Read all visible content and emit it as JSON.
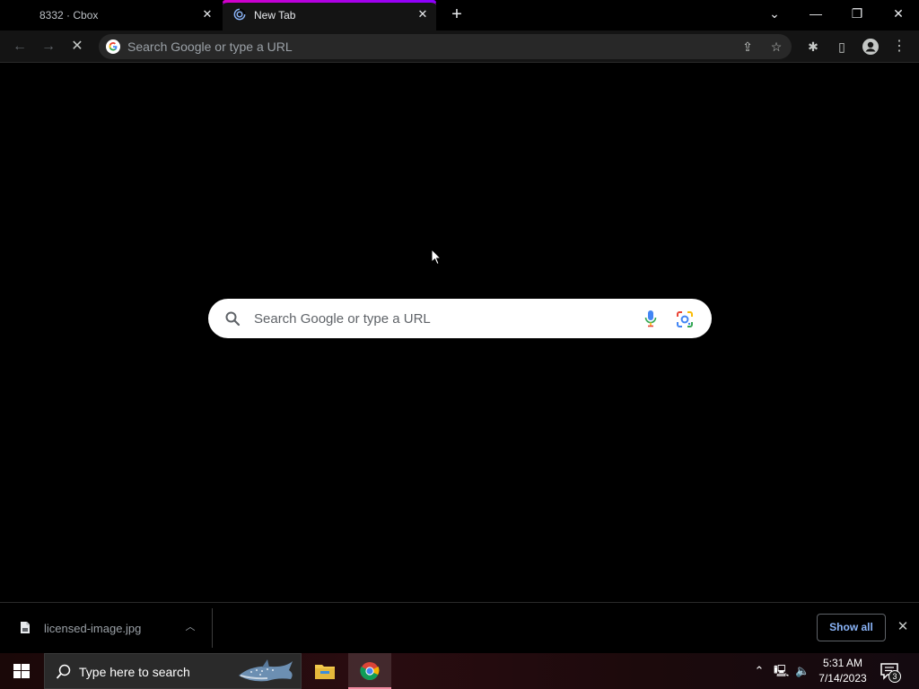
{
  "browser": {
    "tabs": [
      {
        "title": "8332 · Cbox",
        "active": false
      },
      {
        "title": "New Tab",
        "active": true
      }
    ],
    "omnibox": {
      "placeholder": "Search Google or type a URL"
    }
  },
  "ntp": {
    "search_placeholder": "Search Google or type a URL"
  },
  "download_bar": {
    "filename": "licensed-image.jpg",
    "show_all_label": "Show all"
  },
  "taskbar": {
    "search_placeholder": "Type here to search",
    "time": "5:31 AM",
    "date": "7/14/2023",
    "notification_count": "3"
  },
  "colors": {
    "accent_tab": "#b000e0",
    "link_blue": "#8ab4f8",
    "page_bg": "#000000"
  }
}
